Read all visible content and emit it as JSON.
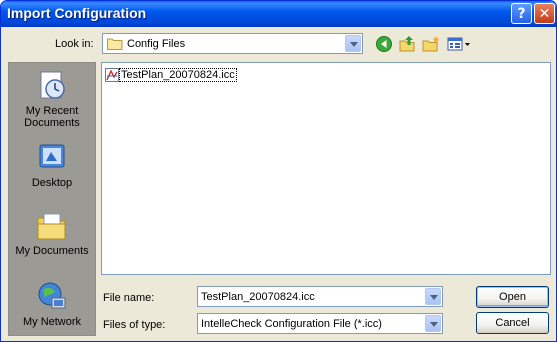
{
  "window": {
    "title": "Import Configuration",
    "help_glyph": "?",
    "close_glyph": "✕"
  },
  "look_in": {
    "label": "Look in:",
    "value": "Config Files"
  },
  "toolbar": {
    "icons": [
      "back-icon",
      "up-folder-icon",
      "new-folder-icon",
      "view-menu-icon"
    ]
  },
  "places_bar": {
    "items": [
      {
        "label": "My Recent Documents",
        "icon": "recent-documents-icon"
      },
      {
        "label": "Desktop",
        "icon": "desktop-icon"
      },
      {
        "label": "My Documents",
        "icon": "my-documents-icon"
      },
      {
        "label": "My Network",
        "icon": "network-icon"
      }
    ]
  },
  "file_list": {
    "items": [
      {
        "name": "TestPlan_20070824.icc",
        "icon": "icc-file-icon"
      }
    ]
  },
  "file_name": {
    "label": "File name:",
    "value": "TestPlan_20070824.icc"
  },
  "file_type": {
    "label": "Files of type:",
    "value": "IntelleCheck Configuration File (*.icc)"
  },
  "buttons": {
    "open": "Open",
    "cancel": "Cancel"
  }
}
